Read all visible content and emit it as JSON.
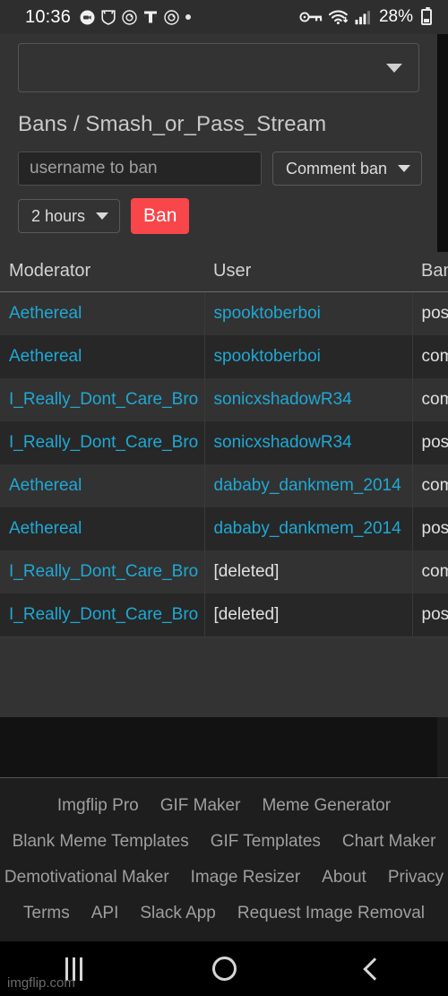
{
  "status_bar": {
    "time": "10:36",
    "left_icons": [
      "zoom-app-icon",
      "shield-app-icon",
      "target-app-icon",
      "t-mobile-icon",
      "target-app-icon-2",
      "dot-icon"
    ],
    "right_icons": [
      "vpn-key-icon",
      "wifi-icon",
      "cellular-signal-icon"
    ],
    "battery_percent": "28%",
    "battery_icon": "battery-icon"
  },
  "stream_select": {
    "value": "",
    "caret_icon": "chevron-down-icon"
  },
  "breadcrumb": "Bans / Smash_or_Pass_Stream",
  "ban_form": {
    "username_placeholder": "username to ban",
    "username_value": "",
    "ban_type": "Comment ban",
    "ban_type_caret": "chevron-down-icon",
    "duration": "2 hours",
    "duration_caret": "chevron-down-icon",
    "submit_label": "Ban",
    "submit_color": "#f9464b"
  },
  "table": {
    "columns": [
      "Moderator",
      "User",
      "Ban Type"
    ],
    "rows": [
      {
        "moderator": "Aethereal",
        "user": "spooktoberboi",
        "user_deleted": false,
        "ban_type": "post"
      },
      {
        "moderator": "Aethereal",
        "user": "spooktoberboi",
        "user_deleted": false,
        "ban_type": "comment"
      },
      {
        "moderator": "I_Really_Dont_Care_Bro",
        "user": "sonicxshadowR34",
        "user_deleted": false,
        "ban_type": "comment"
      },
      {
        "moderator": "I_Really_Dont_Care_Bro",
        "user": "sonicxshadowR34",
        "user_deleted": false,
        "ban_type": "post"
      },
      {
        "moderator": "Aethereal",
        "user": "dababy_dankmem_2014",
        "user_deleted": false,
        "ban_type": "comment"
      },
      {
        "moderator": "Aethereal",
        "user": "dababy_dankmem_2014",
        "user_deleted": false,
        "ban_type": "post"
      },
      {
        "moderator": "I_Really_Dont_Care_Bro",
        "user": "[deleted]",
        "user_deleted": true,
        "ban_type": "comment"
      },
      {
        "moderator": "I_Really_Dont_Care_Bro",
        "user": "[deleted]",
        "user_deleted": true,
        "ban_type": "post"
      }
    ],
    "link_color": "#1fa8d4"
  },
  "footer": {
    "rows": [
      [
        "Imgflip Pro",
        "GIF Maker",
        "Meme Generator"
      ],
      [
        "Blank Meme Templates",
        "GIF Templates",
        "Chart Maker"
      ],
      [
        "Demotivational Maker",
        "Image Resizer",
        "About",
        "Privacy"
      ],
      [
        "Terms",
        "API",
        "Slack App",
        "Request Image Removal"
      ]
    ]
  },
  "nav_bar": {
    "recent_label": "recent-apps",
    "home_label": "home",
    "back_label": "back"
  },
  "watermark": "imgflip.com"
}
